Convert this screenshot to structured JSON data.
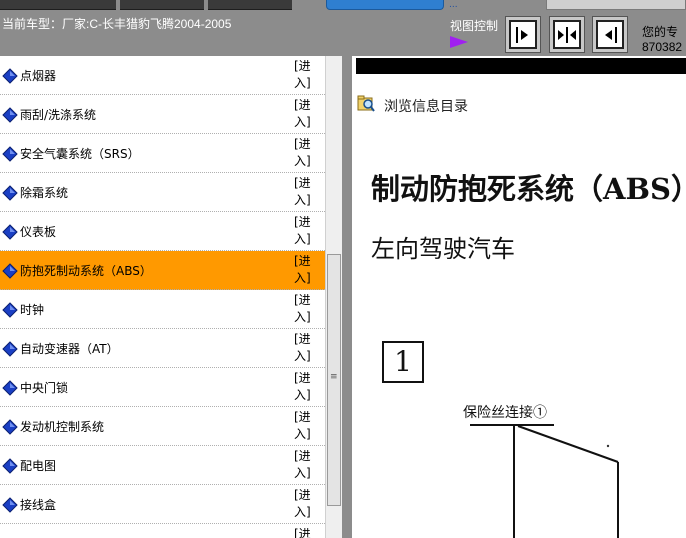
{
  "header": {
    "car_model": "当前车型：厂家:C-长丰猎豹飞腾2004-2005",
    "view_control_label": "视图控制",
    "view_buttons": [
      "expand-right",
      "split",
      "expand-left"
    ],
    "user_line1": "您的专",
    "user_line2": "870382",
    "dots": "..."
  },
  "list": {
    "enter_label": "[进入]",
    "items": [
      {
        "label": "点烟器"
      },
      {
        "label": "雨刮/洗涤系统"
      },
      {
        "label": "安全气囊系统（SRS）"
      },
      {
        "label": "除霜系统"
      },
      {
        "label": "仪表板"
      },
      {
        "label": "防抱死制动系统（ABS）",
        "selected": true
      },
      {
        "label": "时钟"
      },
      {
        "label": "自动变速器（AT）"
      },
      {
        "label": "中央门锁"
      },
      {
        "label": "发动机控制系统"
      },
      {
        "label": "配电图"
      },
      {
        "label": "接线盒"
      },
      {
        "label": ""
      }
    ]
  },
  "content": {
    "browse_label": "浏览信息目录",
    "title": "制动防抱死系统（ABS）",
    "subtitle": "左向驾驶汽车",
    "figure_number": "1",
    "fuse_label": "保险丝连接①"
  },
  "colors": {
    "header_bg": "#8c8c8c",
    "selected_row": "#ff9900",
    "diamond": "#1a3fc4",
    "arrow": "#a020f0"
  }
}
